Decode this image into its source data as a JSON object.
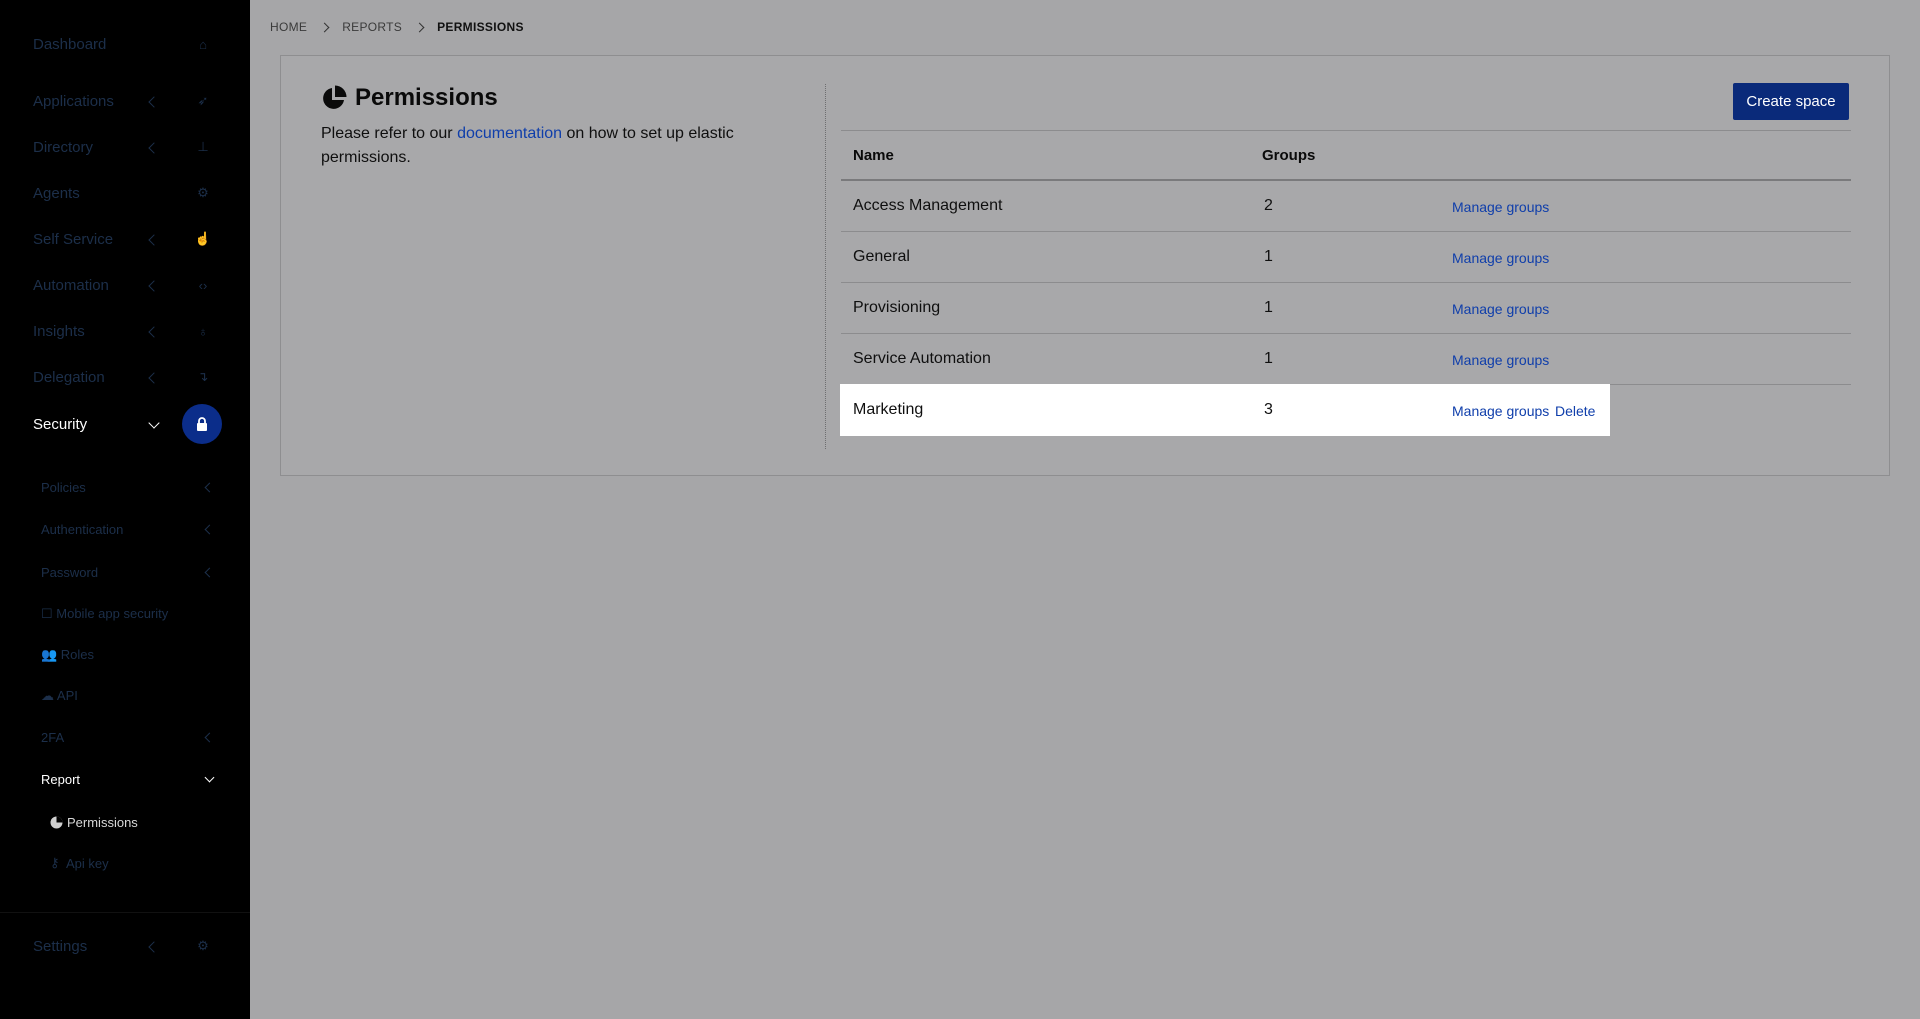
{
  "sidebar": {
    "items": [
      {
        "label": "Dashboard",
        "icon": "home-icon",
        "chevron": false
      },
      {
        "label": "Applications",
        "icon": "rocket-icon",
        "chevron": true
      },
      {
        "label": "Directory",
        "icon": "sitemap-icon",
        "chevron": true
      },
      {
        "label": "Agents",
        "icon": "agents-icon",
        "chevron": false
      },
      {
        "label": "Self Service",
        "icon": "hand-icon",
        "chevron": true
      },
      {
        "label": "Automation",
        "icon": "code-icon",
        "chevron": true
      },
      {
        "label": "Insights",
        "icon": "lightbulb-icon",
        "chevron": true
      },
      {
        "label": "Delegation",
        "icon": "arrow-turn-icon",
        "chevron": true
      },
      {
        "label": "Security",
        "icon": "lock-icon",
        "chevron": true,
        "active": true
      }
    ],
    "security_sub": [
      {
        "label": "Policies",
        "chevron": true
      },
      {
        "label": "Authentication",
        "chevron": true
      },
      {
        "label": "Password",
        "chevron": true
      },
      {
        "label": "☐ Mobile app security",
        "chevron": false
      },
      {
        "label": "👥 Roles",
        "chevron": false
      },
      {
        "label": "☁ API",
        "chevron": false
      },
      {
        "label": "2FA",
        "chevron": true
      },
      {
        "label": "Report",
        "chevron": true,
        "open": true
      }
    ],
    "report_sub": [
      {
        "label": "Permissions",
        "icon": "pie-chart-icon",
        "current": true
      },
      {
        "label": "Api key",
        "icon": "key-icon"
      }
    ],
    "settings": {
      "label": "Settings",
      "icon": "gear-icon"
    }
  },
  "breadcrumb": [
    "HOME",
    "REPORTS",
    "PERMISSIONS"
  ],
  "page": {
    "title": "Permissions",
    "intro_before": "Please refer to our ",
    "intro_link": "documentation",
    "intro_after": " on how to set up elastic permissions.",
    "create_button": "Create space"
  },
  "table": {
    "headers": {
      "name": "Name",
      "groups": "Groups"
    },
    "rows": [
      {
        "name": "Access Management",
        "groups": "2",
        "manage": "Manage groups"
      },
      {
        "name": "General",
        "groups": "1",
        "manage": "Manage groups"
      },
      {
        "name": "Provisioning",
        "groups": "1",
        "manage": "Manage groups"
      },
      {
        "name": "Service Automation",
        "groups": "1",
        "manage": "Manage groups"
      },
      {
        "name": "Marketing",
        "groups": "3",
        "manage": "Manage groups",
        "delete": "Delete"
      }
    ]
  },
  "colors": {
    "accent": "#0a2a7a",
    "link": "#0f3eab",
    "sidebar_bg": "#000000",
    "overlay": "#a6a6a8"
  }
}
